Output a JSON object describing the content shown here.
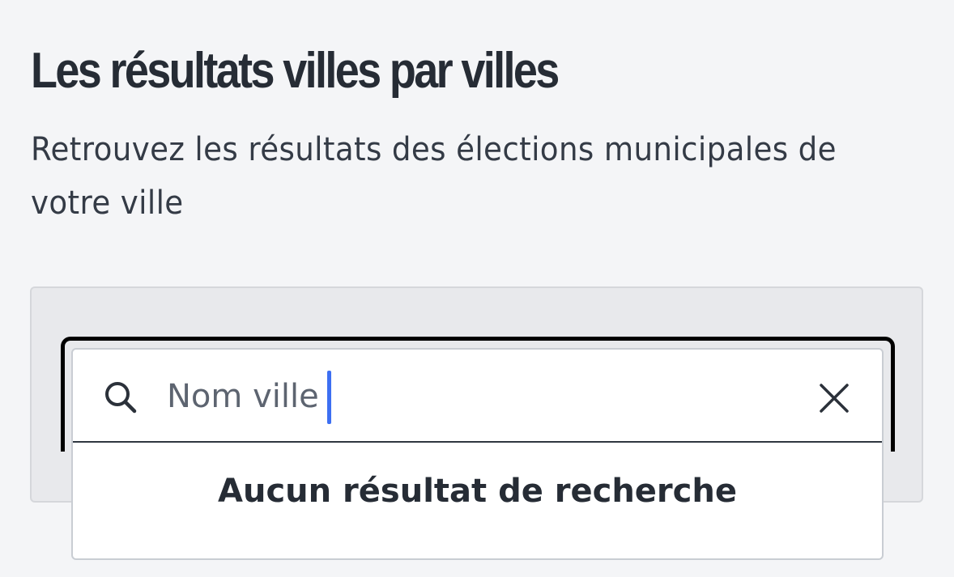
{
  "header": {
    "title": "Les résultats villes par villes",
    "subtitle": "Retrouvez les résultats des élections municipales de votre ville"
  },
  "search": {
    "placeholder": "Nom ville",
    "value": "",
    "icon": "search-icon",
    "clear_icon": "close-icon",
    "caret_color": "#3d6ff2",
    "empty_message": "Aucun résultat de recherche"
  },
  "colors": {
    "page_background": "#f4f5f7",
    "panel_background": "#e8e9ec",
    "text": "#262c35"
  }
}
